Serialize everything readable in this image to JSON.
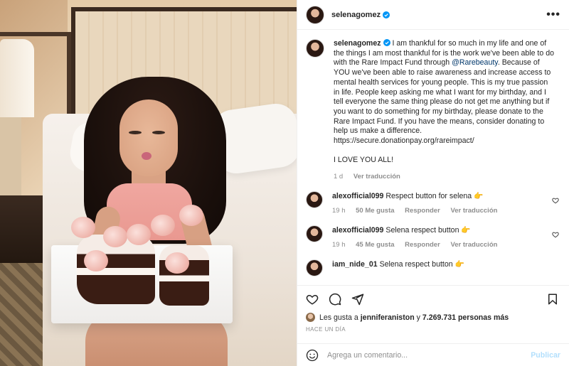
{
  "post": {
    "author": "selenagomez",
    "verified": true,
    "more_icon": "more-horizontal-icon"
  },
  "caption": {
    "author": "selenagomez",
    "text_1": " I am thankful for so much in my life and one of the things I am most thankful for is the work we've been able to do with the Rare Impact Fund through ",
    "mention": "@Rarebeauty",
    "text_2": ". Because of YOU we've been able to raise awareness and increase access to mental health services for young people. This is my true passion in life. People keep asking me what I want for my birthday, and I tell everyone the same thing please do not get me anything but if you want to do something for my birthday, please donate to the Rare Impact Fund. If you have the means, consider donating to help us make a difference.",
    "link": "https://secure.donationpay.org/rareimpact/",
    "closing": "I LOVE YOU ALL!",
    "time": "1 d",
    "translate": "Ver traducción"
  },
  "comments": [
    {
      "user": "alexofficial099",
      "text": "Respect button for selena 👉",
      "time": "19 h",
      "likes": "50 Me gusta",
      "reply": "Responder",
      "translate": "Ver traducción"
    },
    {
      "user": "alexofficial099",
      "text": "Selena respect button 👉",
      "time": "19 h",
      "likes": "45 Me gusta",
      "reply": "Responder",
      "translate": "Ver traducción"
    },
    {
      "user": "iam_nide_01",
      "text": "Selena respect button 👉",
      "time": "",
      "likes": "",
      "reply": "",
      "translate": ""
    }
  ],
  "likes": {
    "prefix": "Les gusta a ",
    "friend": "jenniferaniston",
    "middle": " y ",
    "count": "7.269.731 personas más"
  },
  "posted_ago": "HACE UN DÍA",
  "composer": {
    "placeholder": "Agrega un comentario...",
    "publish": "Publicar"
  },
  "colors": {
    "verified": "#0095f6",
    "link": "#00376b",
    "muted": "#8e8e8e",
    "publish_disabled": "#b2dffc"
  }
}
